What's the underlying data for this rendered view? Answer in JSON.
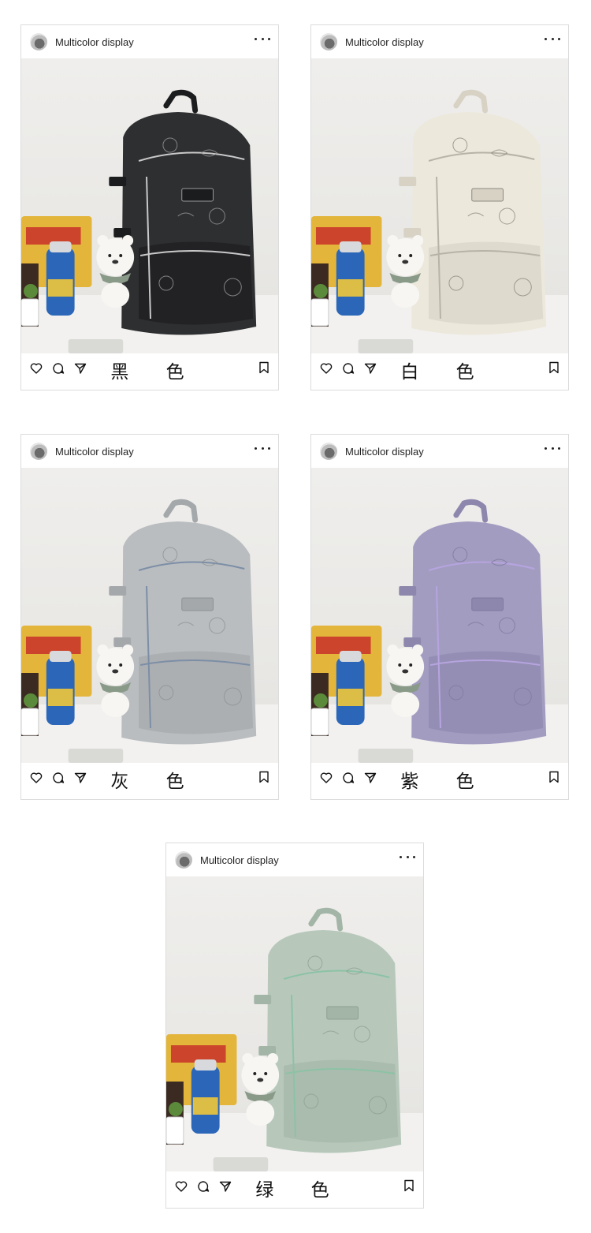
{
  "account": {
    "username": "Multicolor display"
  },
  "cards": [
    {
      "caption": "黑 色",
      "colors": {
        "bag": "#2e2f31",
        "dark": "#1b1c1e",
        "line": "#9a9a9a",
        "zip": "#c9c9c9"
      }
    },
    {
      "caption": "白 色",
      "colors": {
        "bag": "#ece8dc",
        "dark": "#d7d2c4",
        "line": "#8d8a80",
        "zip": "#b7b3a7"
      }
    },
    {
      "caption": "灰 色",
      "colors": {
        "bag": "#b9bdc0",
        "dark": "#a4a8ab",
        "line": "#8d9295",
        "zip": "#7c8ea6"
      }
    },
    {
      "caption": "紫 色",
      "colors": {
        "bag": "#a39cc1",
        "dark": "#8e87ad",
        "line": "#7f78a0",
        "zip": "#b6a4df"
      }
    },
    {
      "caption": "绿 色",
      "colors": {
        "bag": "#b7c8bb",
        "dark": "#a3b5a7",
        "line": "#8fa193",
        "zip": "#8cc2a5"
      }
    }
  ],
  "icons": [
    "heart-icon",
    "comment-icon",
    "share-icon",
    "bookmark-icon",
    "more-icon"
  ]
}
